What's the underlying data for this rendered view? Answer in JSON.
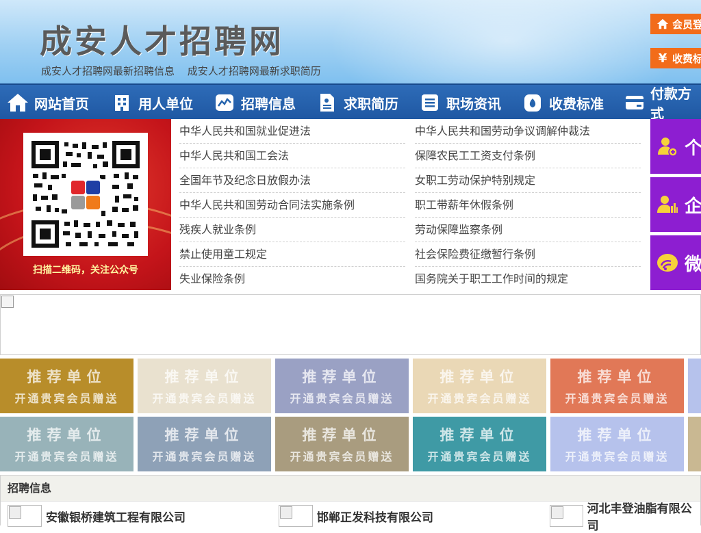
{
  "header": {
    "site_title": "成安人才招聘网",
    "sub_links": [
      "成安人才招聘网最新招聘信息",
      "成安人才招聘网最新求职简历"
    ],
    "login_label": "会员登",
    "fee_label": "收费标"
  },
  "nav": {
    "items": [
      {
        "label": "网站首页",
        "icon": "home-icon"
      },
      {
        "label": "用人单位",
        "icon": "building-icon"
      },
      {
        "label": "招聘信息",
        "icon": "chart-icon"
      },
      {
        "label": "求职简历",
        "icon": "document-icon"
      },
      {
        "label": "职场资讯",
        "icon": "list-icon"
      },
      {
        "label": "收费标准",
        "icon": "money-bag-icon"
      },
      {
        "label": "付款方式",
        "icon": "card-icon"
      }
    ]
  },
  "qr": {
    "caption": "扫描二维码，关注公众号"
  },
  "laws": [
    "中华人民共和国就业促进法",
    "中华人民共和国劳动争议调解仲裁法",
    "中华人民共和国工会法",
    "保障农民工工资支付条例",
    "全国年节及纪念日放假办法",
    "女职工劳动保护特别规定",
    "中华人民共和国劳动合同法实施条例",
    "职工带薪年休假条例",
    "残疾人就业条例",
    "劳动保障监察条例",
    "禁止使用童工规定",
    "社会保险费征缴暂行条例",
    "失业保险条例",
    "国务院关于职工工作时间的规定"
  ],
  "side_buttons": [
    {
      "label": "个",
      "icon": "person-add-icon"
    },
    {
      "label": "企",
      "icon": "enterprise-icon"
    },
    {
      "label": "微",
      "icon": "wechat-icon"
    }
  ],
  "tiles": {
    "title": "推荐单位",
    "subtitle": "开通贵宾会员赠送",
    "row1_colors": [
      "#b88d2a",
      "#e9e1cf",
      "#9aa1c4",
      "#ead8b6",
      "#e17857"
    ],
    "row2_colors": [
      "#98b3b9",
      "#8ea1b7",
      "#a99c7f",
      "#3f9aa5",
      "#b6c2ec"
    ]
  },
  "recruit": {
    "heading": "招聘信息",
    "companies": [
      "安徽银桥建筑工程有限公司",
      "邯郸正发科技有限公司",
      "河北丰登油脂有限公司"
    ]
  }
}
